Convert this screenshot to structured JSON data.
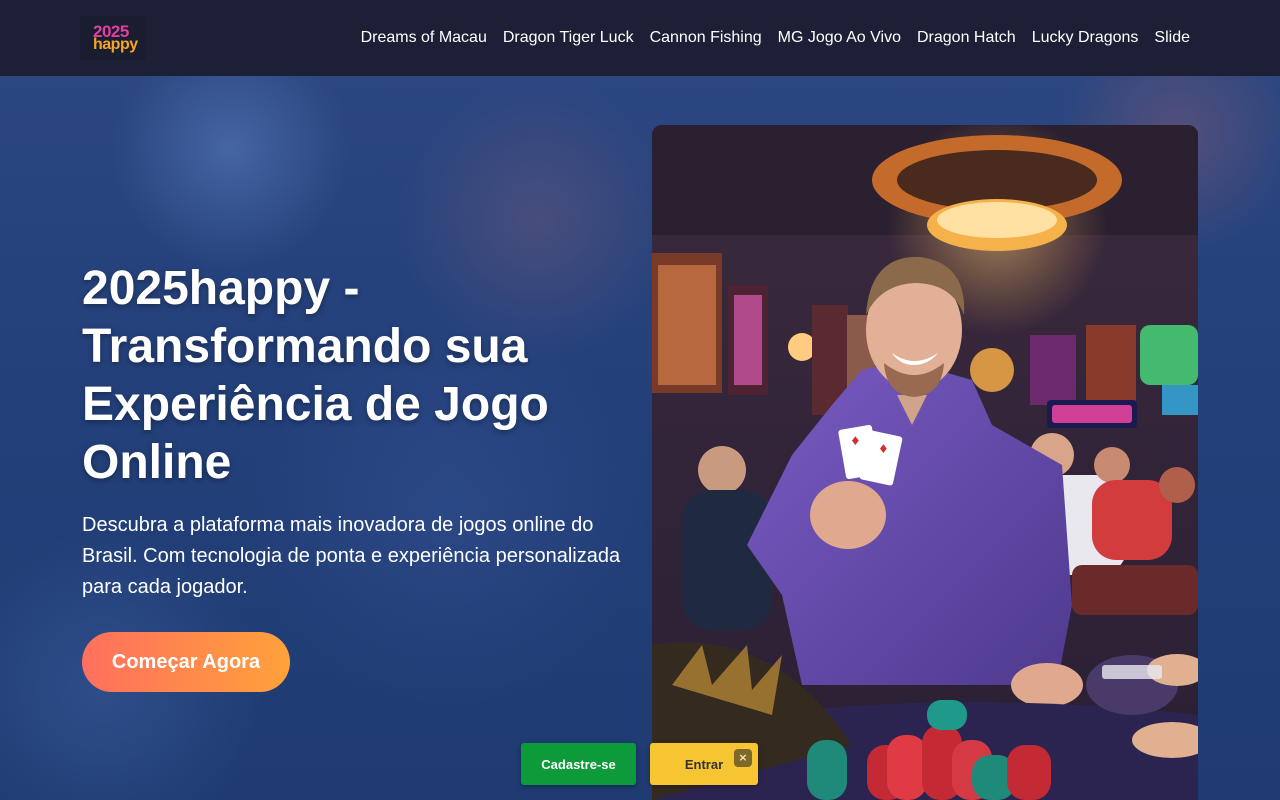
{
  "header": {
    "logo_top": "2025",
    "logo_bottom": "happy",
    "nav": [
      "Dreams of Macau",
      "Dragon Tiger Luck",
      "Cannon Fishing",
      "MG Jogo Ao Vivo",
      "Dragon Hatch",
      "Lucky Dragons",
      "Slide"
    ]
  },
  "hero": {
    "title": "2025happy - Transformando sua Experiência de Jogo Online",
    "subtitle": "Descubra a plataforma mais inovadora de jogos online do Brasil. Com tecnologia de ponta e experiência personalizada para cada jogador.",
    "cta_label": "Começar Agora"
  },
  "floating": {
    "register_label": "Cadastre-se",
    "login_label": "Entrar",
    "close_icon": "×"
  },
  "colors": {
    "header_bg": "#1c1f35",
    "cta_start": "#ff6f5e",
    "cta_end": "#ffa23a",
    "register_bg": "#0c9a3a",
    "login_bg": "#f7c531"
  }
}
